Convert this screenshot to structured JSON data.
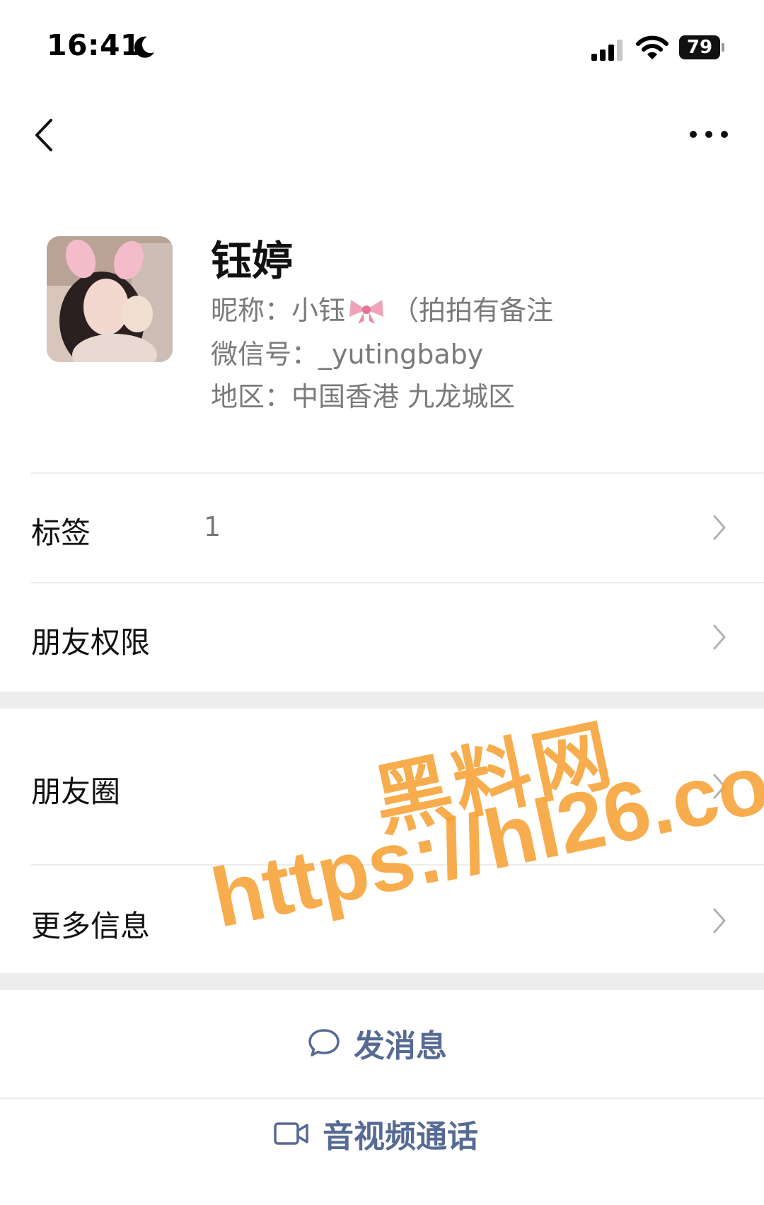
{
  "status_bar": {
    "time": "16:41",
    "battery_level": "79",
    "icons": [
      "moon-icon",
      "signal-icon",
      "wifi-icon",
      "battery-icon"
    ]
  },
  "nav": {
    "back_icon": "chevron-left-icon",
    "more_icon": "more-dots-icon"
  },
  "profile": {
    "name": "钰婷",
    "nickname_label": "昵称：",
    "nickname_prefix": "小钰",
    "nickname_suffix": "（拍拍有备注",
    "wechat_label": "微信号：",
    "wechat_id": "_yutingbaby",
    "region_label": "地区：",
    "region": "中国香港 九龙城区"
  },
  "rows": [
    {
      "label": "标签",
      "value": "1"
    },
    {
      "label": "朋友权限",
      "value": ""
    },
    {
      "label": "朋友圈",
      "value": ""
    },
    {
      "label": "更多信息",
      "value": ""
    }
  ],
  "actions": {
    "message": "发消息",
    "call": "音视频通话"
  },
  "watermark": {
    "title": "黑料网",
    "url": "https://hl26.co"
  },
  "colors": {
    "accent": "#566a94",
    "watermark": "#f7a53a",
    "secondary_text": "#7a7a7a",
    "band": "#ededed"
  }
}
